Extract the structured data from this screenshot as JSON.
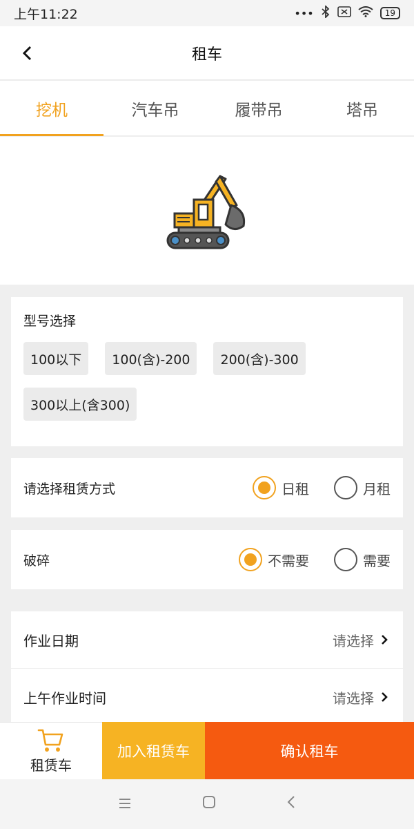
{
  "status_bar": {
    "time": "上午11:22",
    "battery": "19"
  },
  "nav": {
    "title": "租车"
  },
  "tabs": [
    "挖机",
    "汽车吊",
    "履带吊",
    "塔吊"
  ],
  "model": {
    "title": "型号选择",
    "options": [
      "100以下",
      "100(含)-200",
      "200(含)-300",
      "300以上(含300)"
    ]
  },
  "rent_mode": {
    "label": "请选择租赁方式",
    "options": [
      "日租",
      "月租"
    ],
    "selected": "日租"
  },
  "breaking": {
    "label": "破碎",
    "options": [
      "不需要",
      "需要"
    ],
    "selected": "不需要"
  },
  "list": [
    {
      "label": "作业日期",
      "value": "请选择"
    },
    {
      "label": "上午作业时间",
      "value": "请选择"
    }
  ],
  "bottom": {
    "cart_label": "租赁车",
    "add_label": "加入租赁车",
    "confirm_label": "确认租车"
  },
  "colors": {
    "accent": "#f1a21f",
    "add": "#f6b323",
    "confirm": "#f55a10"
  }
}
